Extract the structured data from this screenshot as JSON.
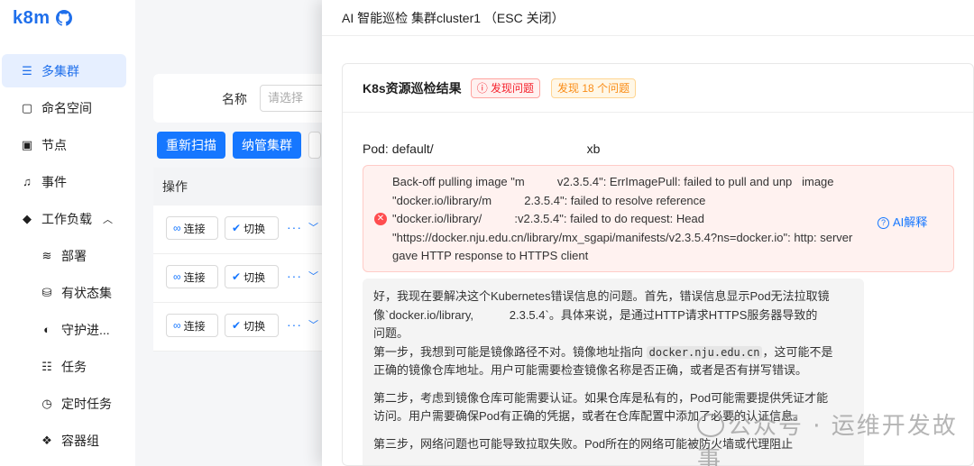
{
  "app": {
    "logo": "k8m"
  },
  "sidebar": {
    "items": [
      {
        "label": "多集群",
        "icon": "server-icon"
      },
      {
        "label": "命名空间",
        "icon": "namespace-icon"
      },
      {
        "label": "节点",
        "icon": "node-icon"
      },
      {
        "label": "事件",
        "icon": "bell-icon"
      },
      {
        "label": "工作负载",
        "icon": "cube-icon"
      },
      {
        "label": "部署",
        "icon": "layers-icon"
      },
      {
        "label": "有状态集",
        "icon": "database-icon"
      },
      {
        "label": "守护进...",
        "icon": "shield-icon"
      },
      {
        "label": "任务",
        "icon": "task-list-icon"
      },
      {
        "label": "定时任务",
        "icon": "clock-icon"
      },
      {
        "label": "容器组",
        "icon": "pods-icon"
      }
    ]
  },
  "main": {
    "filter": {
      "label": "名称",
      "placeholder": "请选择"
    },
    "buttons": {
      "rescan": "重新扫描",
      "manage": "纳管集群"
    },
    "table": {
      "op_header": "操作",
      "row_actions": {
        "connect": "连接",
        "switch": "切换",
        "more": "···"
      }
    }
  },
  "drawer": {
    "title": "AI 智能巡检 集群cluster1 （ESC 关闭）",
    "result_title": "K8s资源巡检结果",
    "tag_found": "发现问题",
    "tag_count": "发现 18 个问题",
    "pod_label": "Pod: default/",
    "pod_suffix": "xb",
    "alert": {
      "line1": "Back-off pulling image \"m          v2.3.5.4\": ErrImagePull: failed to pull and unp   image",
      "line2": "\"docker.io/library/m          2.3.5.4\": failed to resolve reference",
      "line3": "\"docker.io/library/          :v2.3.5.4\": failed to do request: Head",
      "line4": "\"https://docker.nju.edu.cn/library/mx_sgapi/manifests/v2.3.5.4?ns=docker.io\": http: server",
      "line5": "gave HTTP response to HTTPS client",
      "ai_button": "AI解释"
    },
    "analysis": {
      "p1_a": "好，我现在要解决这个Kubernetes错误信息的问题。首先，错误信息显示Pod无法拉取镜",
      "p1_b": "像`docker.io/library,           2.3.5.4`。具体来说，是通过HTTP请求HTTPS服务器导致的",
      "p1_c": "问题。",
      "p2_a": "第一步，我想到可能是镜像路径不对。镜像地址指向",
      "p2_code": "docker.nju.edu.cn",
      "p2_b": "，这可能不是",
      "p2_c": "正确的镜像仓库地址。用户可能需要检查镜像名称是否正确，或者是否有拼写错误。",
      "p3_a": "第二步，考虑到镜像仓库可能需要认证。如果仓库是私有的，Pod可能需要提供凭证才能",
      "p3_b": "访问。用户需要确保Pod有正确的凭据，或者在仓库配置中添加了必要的认证信息。",
      "p4_a": "第三步，网络问题也可能导致拉取失败。Pod所在的网络可能被防火墙或代理阻止"
    }
  },
  "watermark": "公众号 · 运维开发故事"
}
